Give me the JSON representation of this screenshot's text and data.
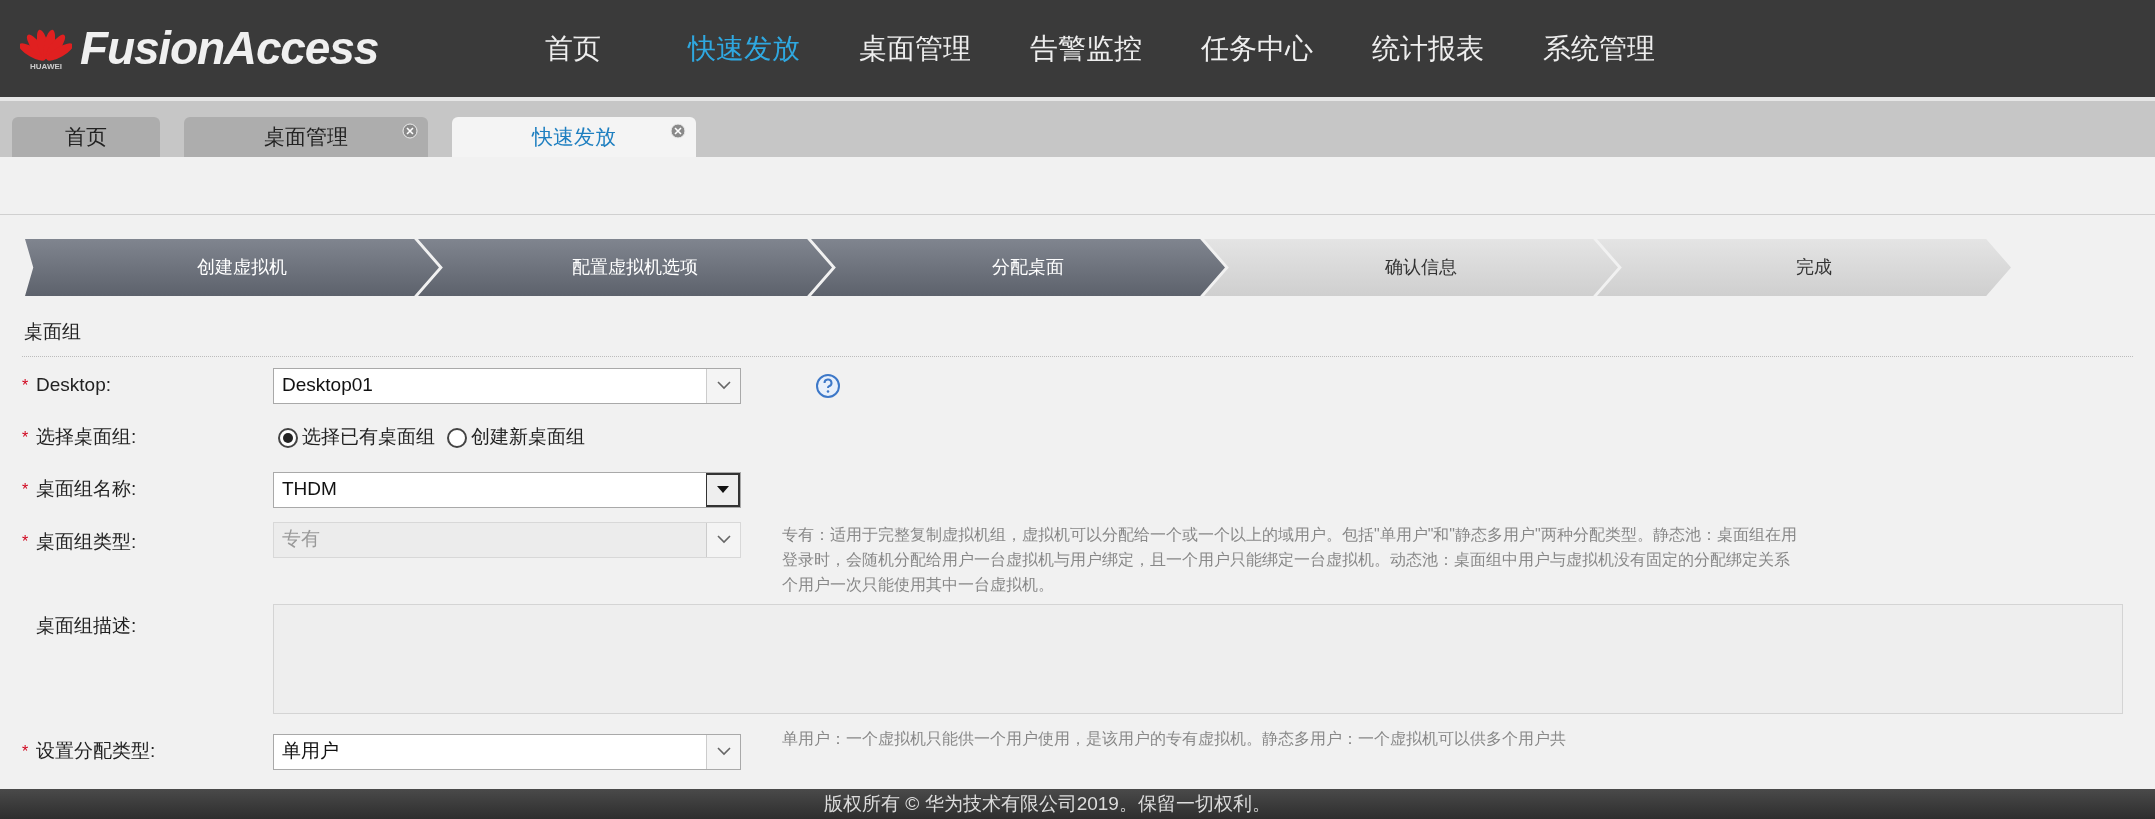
{
  "header": {
    "logo_brand": "HUAWEI",
    "product": "FusionAccess",
    "nav": [
      {
        "label": "首页",
        "selected": false
      },
      {
        "label": "快速发放",
        "selected": true
      },
      {
        "label": "桌面管理",
        "selected": false
      },
      {
        "label": "告警监控",
        "selected": false
      },
      {
        "label": "任务中心",
        "selected": false
      },
      {
        "label": "统计报表",
        "selected": false
      },
      {
        "label": "系统管理",
        "selected": false
      }
    ]
  },
  "tabs": [
    {
      "label": "首页",
      "selected": false
    },
    {
      "label": "桌面管理",
      "selected": false,
      "closable": true
    },
    {
      "label": "快速发放",
      "selected": true,
      "closable": true
    }
  ],
  "steps": [
    {
      "label": "创建虚拟机",
      "completed": true
    },
    {
      "label": "配置虚拟机选项",
      "completed": true
    },
    {
      "label": "分配桌面",
      "completed": true
    },
    {
      "label": "确认信息",
      "completed": false
    },
    {
      "label": "完成",
      "completed": false
    }
  ],
  "section_title": "桌面组",
  "fields": [
    {
      "kind": "select",
      "marker": "*",
      "label": "Desktop:",
      "value": "Desktop01",
      "disabled": false,
      "help": true
    },
    {
      "kind": "radio",
      "marker": "*",
      "label": "选择桌面组:",
      "options": [
        {
          "label": "选择已有桌面组",
          "selected": true
        },
        {
          "label": "创建新桌面组",
          "selected": false
        }
      ]
    },
    {
      "kind": "combo",
      "marker": "*",
      "label": "桌面组名称:",
      "value": "THDM"
    },
    {
      "kind": "select",
      "marker": "*",
      "label": "桌面组类型:",
      "value": "专有",
      "disabled": true,
      "hint": [
        "专有：适用于完整复制虚拟机组，虚拟机可以分配给一个或一个以上的域用户。包括\"单用户\"和\"静态多用户\"两种分配类型。静态池：桌面组在用",
        "登录时，会随机分配给用户一台虚拟机与用户绑定，且一个用户只能绑定一台虚拟机。动态池：桌面组中用户与虚拟机没有固定的分配绑定关系",
        "个用户一次只能使用其中一台虚拟机。"
      ]
    },
    {
      "kind": "textarea",
      "label": "桌面组描述:"
    },
    {
      "kind": "select",
      "marker": "*",
      "label": "设置分配类型:",
      "value": "单用户",
      "disabled": false,
      "hint": [
        "单用户：一个虚拟机只能供一个用户使用，是该用户的专有虚拟机。静态多用户：一个虚拟机可以供多个用户共"
      ]
    }
  ],
  "footer": "版权所有 © 华为技术有限公司2019。保留一切权利。"
}
